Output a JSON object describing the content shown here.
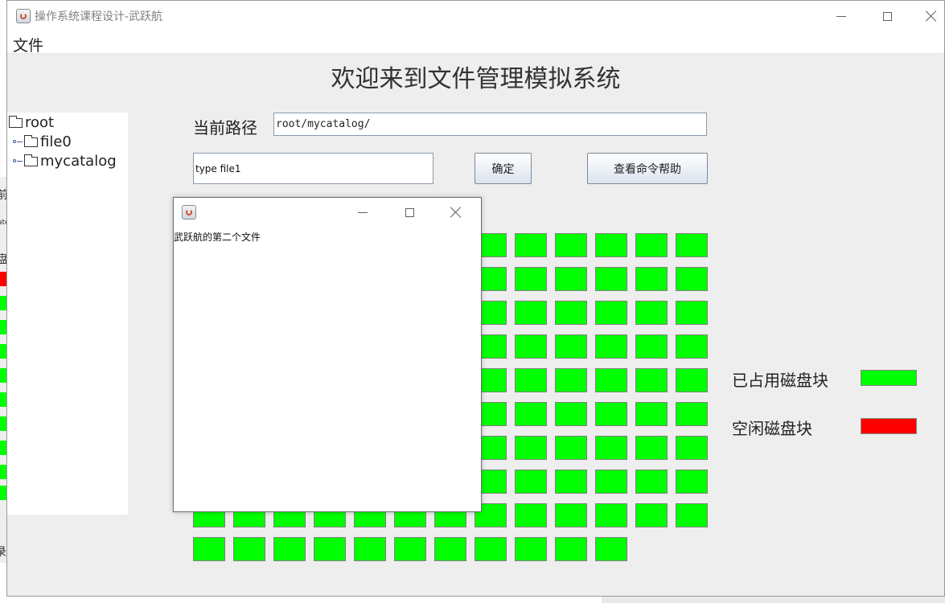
{
  "window": {
    "title": "操作系统课程设计-武跃航"
  },
  "menu": {
    "file_label": "文件"
  },
  "main": {
    "welcome_text": "欢迎来到文件管理模拟系统",
    "path_label": "当前路径",
    "path_value": "root/mycatalog/",
    "command_value": "type file1",
    "confirm_label": "确定",
    "help_label": "查看命令帮助"
  },
  "tree": {
    "root": "root",
    "children": [
      "file0",
      "mycatalog"
    ]
  },
  "disk": {
    "rows": 10,
    "columns": 13,
    "total_blocks": 128,
    "used_color": "#00ff00",
    "free_color": "#ff0000"
  },
  "legend": {
    "used_label": "已占用磁盘块",
    "free_label": "空闲磁盘块",
    "used_color": "#00ff00",
    "free_color": "#ff0000"
  },
  "file_window": {
    "content": "武跃航的第二个文件"
  },
  "background": {
    "partial_labels": [
      "前",
      "ate",
      "盘",
      "录"
    ]
  }
}
